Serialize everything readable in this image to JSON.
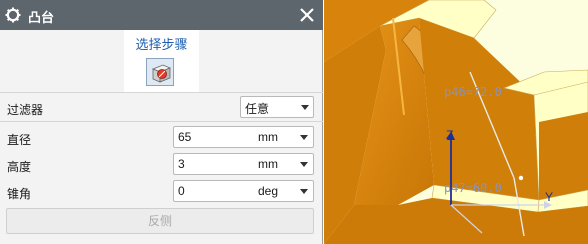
{
  "dialog": {
    "title": "凸台",
    "select_step_label": "选择步骤"
  },
  "filter": {
    "label": "过滤器",
    "value": "任意"
  },
  "params": [
    {
      "label": "直径",
      "value": "65",
      "unit": "mm"
    },
    {
      "label": "高度",
      "value": "3",
      "unit": "mm"
    },
    {
      "label": "锥角",
      "value": "0",
      "unit": "deg"
    }
  ],
  "flip_button": "反侧",
  "viewport": {
    "annotation_1": "p46=72.0",
    "annotation_2": "p47=60.0",
    "axis_y": "Y",
    "axis_z": "Z",
    "colors": {
      "solid": "#d9840c",
      "highlight": "#ffffc8",
      "axis": "#1c2e9a"
    }
  },
  "icons": [
    "gear-icon",
    "close-icon",
    "select-face-icon",
    "chevron-down-icon"
  ]
}
